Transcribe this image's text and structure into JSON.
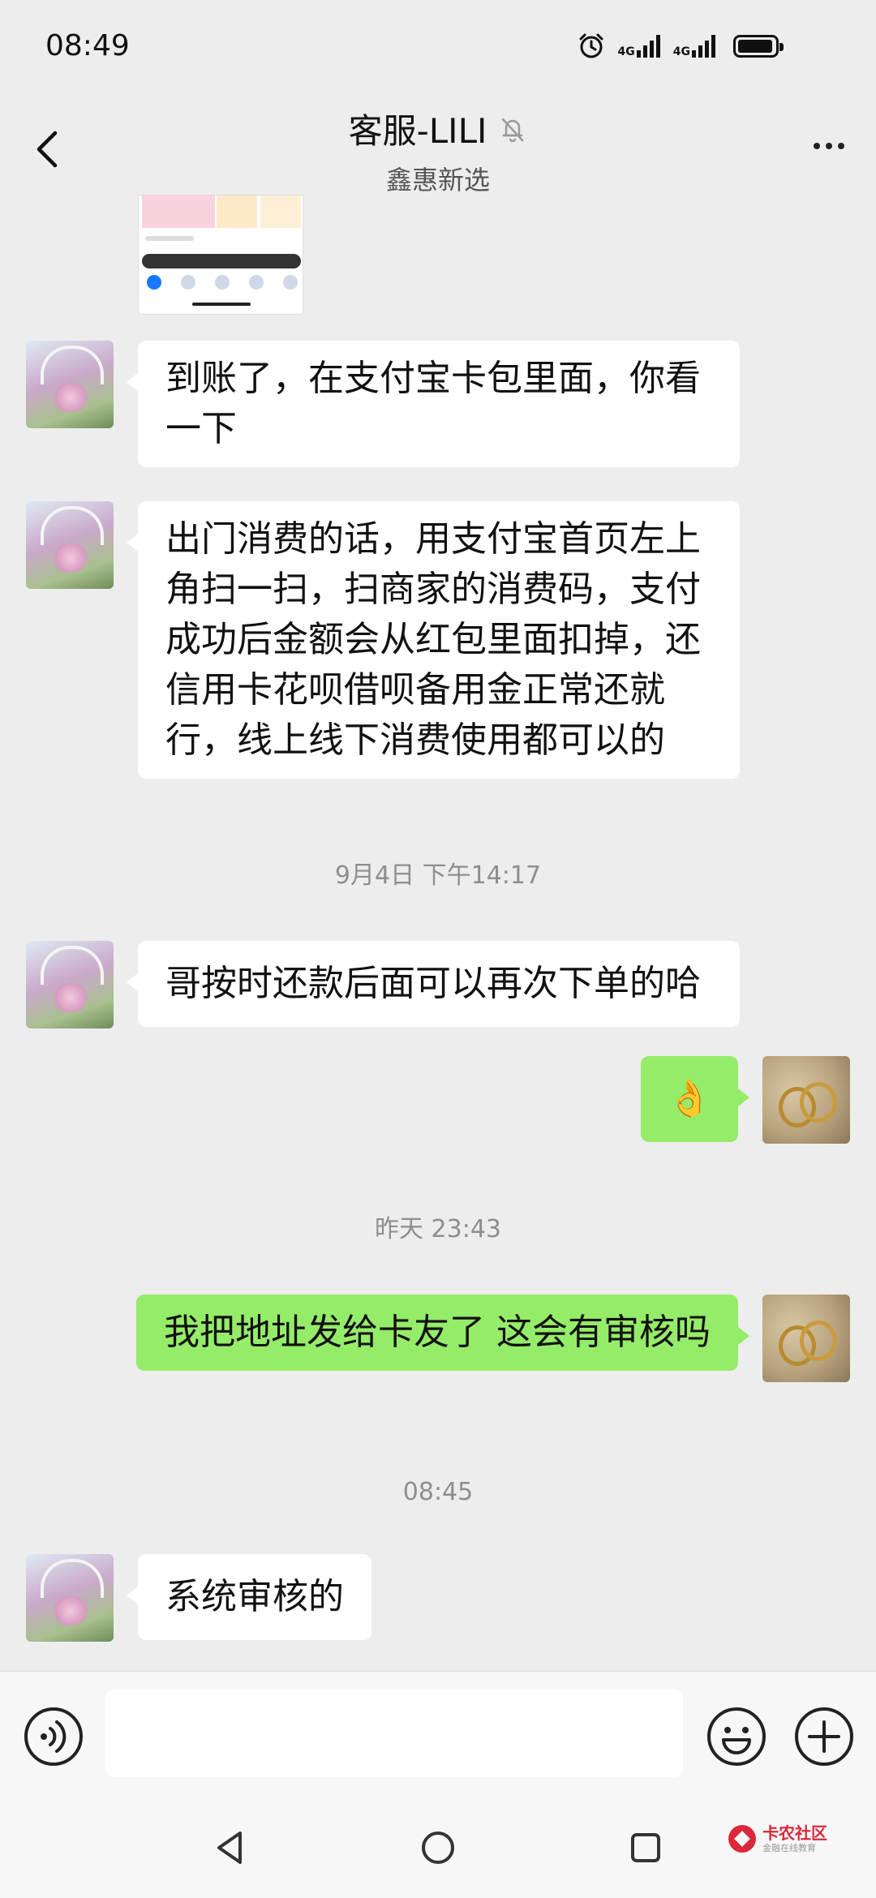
{
  "status_bar": {
    "time": "08:49",
    "network_1": "4G",
    "network_2": "4G",
    "battery_level": 0.95
  },
  "nav": {
    "title": "客服-LILI",
    "subtitle": "鑫惠新选",
    "back_icon": "chevron-left-icon",
    "mute_icon": "bell-off-icon",
    "more_icon": "more-dots-icon"
  },
  "messages": [
    {
      "type": "image",
      "sender": "agent",
      "desc": "screenshot thumbnail"
    },
    {
      "type": "text",
      "sender": "agent",
      "text": "到账了，在支付宝卡包里面，你看一下"
    },
    {
      "type": "text",
      "sender": "agent",
      "text": "出门消费的话，用支付宝首页左上角扫一扫，扫商家的消费码，支付成功后金额会从红包里面扣掉，还信用卡花呗借呗备用金正常还就行，线上线下消费使用都可以的"
    },
    {
      "type": "time",
      "text": "9月4日 下午14:17"
    },
    {
      "type": "text",
      "sender": "agent",
      "text": "哥按时还款后面可以再次下单的哈"
    },
    {
      "type": "text",
      "sender": "me",
      "text": "👌"
    },
    {
      "type": "time",
      "text": "昨天 23:43"
    },
    {
      "type": "text",
      "sender": "me",
      "text": "我把地址发给卡友了 这会有审核吗"
    },
    {
      "type": "time",
      "text": "08:45"
    },
    {
      "type": "text",
      "sender": "agent",
      "text": "系统审核的"
    }
  ],
  "input_bar": {
    "value": "",
    "voice_icon": "voice-icon",
    "emoji_icon": "emoji-icon",
    "plus_icon": "plus-icon"
  },
  "system_nav": {
    "back_icon": "triangle-back-icon",
    "home_icon": "circle-home-icon",
    "recents_icon": "square-recents-icon"
  },
  "watermark": {
    "title": "卡农社区",
    "subtitle": "金融在线教育"
  },
  "colors": {
    "background": "#ededed",
    "bubble_in": "#ffffff",
    "bubble_out": "#95ec69",
    "timestamp": "#8e8e8e",
    "watermark": "#d9293a"
  }
}
